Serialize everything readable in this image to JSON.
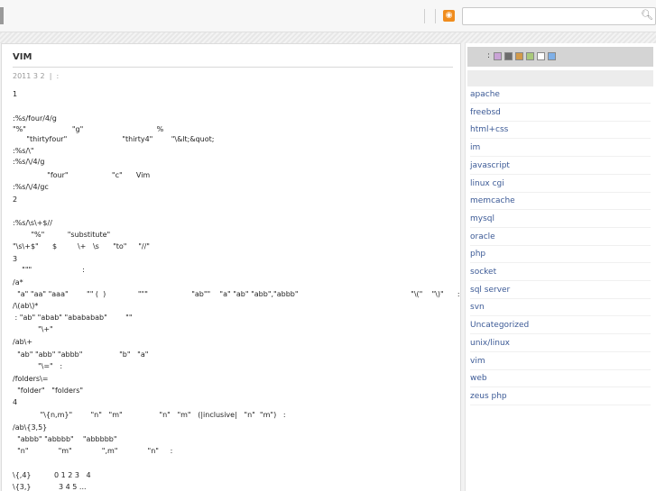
{
  "header": {
    "rss_icon": "rss-feed-icon",
    "search_placeholder": "",
    "search_icon": "magnifier-icon"
  },
  "post": {
    "title": "VIM",
    "meta": "2011 3 2  |  :",
    "lines": [
      {
        "text": "1"
      },
      {
        "text": ":%s/four/4/g"
      },
      {
        "text": "\"%\"                    \"g\"                                %"
      },
      {
        "text": "      \"thirtyfour\"                        \"thirty4\"        \"\\&lt;&quot;"
      },
      {
        "text": ":%s/\\\""
      },
      {
        "text": ":%s/\\/4/g"
      },
      {
        "text": "               \"four\"                   \"c\"      Vim"
      },
      {
        "text": ":%s/\\/4/gc"
      },
      {
        "text": "2"
      },
      {
        "text": ":%s/\\s\\+$//"
      },
      {
        "text": "        \"%\"          \"substitute\""
      },
      {
        "text": "\"\\s\\+$\"      $         \\+   \\s      \"to\"     \"//\""
      },
      {
        "text": "3"
      },
      {
        "text": "    \"\"\"                      :"
      },
      {
        "text": "/a*"
      },
      {
        "text": "  \"a\" \"aa\" \"aaa\"        \"\" (  )              \"\"\"                   \"ab\"\"    \"a\" \"ab\" \"abb\",\"abbb\"                                                 \"\\(\"    \"\\)\"      :"
      },
      {
        "text": "/\\(ab\\)*"
      },
      {
        "text": " : \"ab\" \"abab\" \"abababab\"        \"\""
      },
      {
        "text": "           \"\\+\""
      },
      {
        "text": "/ab\\+"
      },
      {
        "text": "  \"ab\" \"abb\" \"abbb\"                \"b\"   \"a\""
      },
      {
        "text": "           \"\\=\"   :"
      },
      {
        "text": "/folders\\="
      },
      {
        "text": "  \"folder\"   \"folders\""
      },
      {
        "text": "4"
      },
      {
        "text": "            \"\\{n,m}\"        \"n\"   \"m\"                \"n\"   \"m\"   (|inclusive|   \"n\"  \"m\")   :"
      },
      {
        "text": "/ab\\{3,5}"
      },
      {
        "text": "  \"abbb\" \"abbbb\"    \"abbbbb\""
      },
      {
        "text": "  \"n\"             \"m\"             \",m\"             \"n\"     :"
      },
      {
        "text": "\\{,4}          0 1 2 3   4"
      },
      {
        "text": "\\{3,}            3 4 5 ..."
      }
    ]
  },
  "sidebar": {
    "skin_label": ":",
    "swatches": [
      "#c9a3d6",
      "#6c6c6c",
      "#d29a4a",
      "#a9c97b",
      "#ffffff",
      "#7fb0e8"
    ],
    "categories": [
      "apache",
      "freebsd",
      "html+css",
      "im",
      "javascript",
      "linux cgi",
      "memcache",
      "mysql",
      "oracle",
      "php",
      "socket",
      "sql server",
      "svn",
      "Uncategorized",
      "unix/linux",
      "vim",
      "web",
      "zeus php"
    ]
  }
}
